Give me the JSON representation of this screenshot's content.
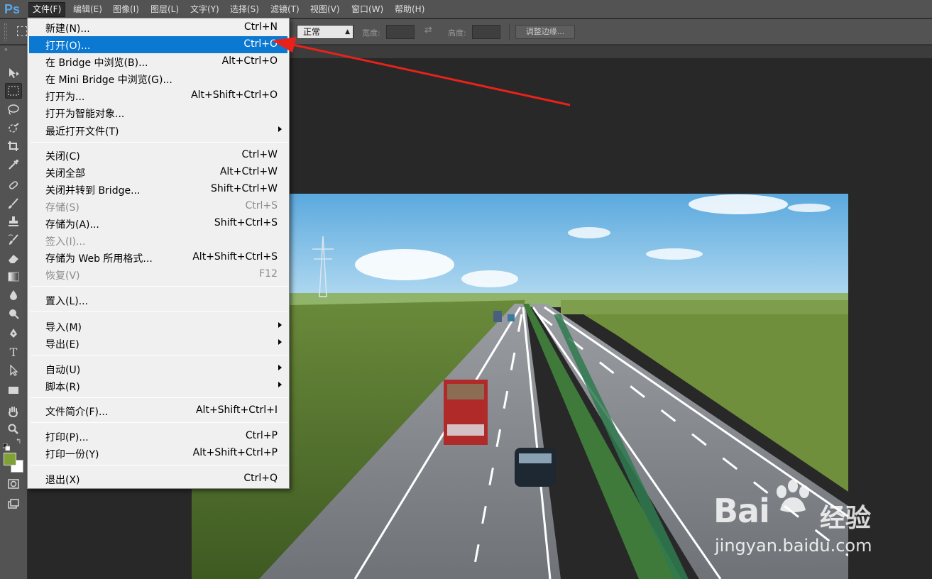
{
  "app": {
    "logo": "Ps"
  },
  "menubar": {
    "items": [
      {
        "label": "文件(F)",
        "active": true
      },
      {
        "label": "编辑(E)"
      },
      {
        "label": "图像(I)"
      },
      {
        "label": "图层(L)"
      },
      {
        "label": "文字(Y)"
      },
      {
        "label": "选择(S)"
      },
      {
        "label": "滤镜(T)"
      },
      {
        "label": "视图(V)"
      },
      {
        "label": "窗口(W)"
      },
      {
        "label": "帮助(H)"
      }
    ]
  },
  "options": {
    "style_value": "正常",
    "width_label": "宽度:",
    "height_label": "高度:",
    "refine_edge_label": "调整边缘..."
  },
  "file_menu": {
    "items": [
      {
        "label": "新建(N)...",
        "shortcut": "Ctrl+N"
      },
      {
        "label": "打开(O)...",
        "shortcut": "Ctrl+O",
        "highlighted": true
      },
      {
        "label": "在 Bridge 中浏览(B)...",
        "shortcut": "Alt+Ctrl+O"
      },
      {
        "label": "在 Mini Bridge 中浏览(G)...",
        "shortcut": ""
      },
      {
        "label": "打开为...",
        "shortcut": "Alt+Shift+Ctrl+O"
      },
      {
        "label": "打开为智能对象...",
        "shortcut": ""
      },
      {
        "label": "最近打开文件(T)",
        "shortcut": "",
        "submenu": true
      },
      {
        "label": "关闭(C)",
        "shortcut": "Ctrl+W"
      },
      {
        "label": "关闭全部",
        "shortcut": "Alt+Ctrl+W"
      },
      {
        "label": "关闭并转到 Bridge...",
        "shortcut": "Shift+Ctrl+W"
      },
      {
        "label": "存储(S)",
        "shortcut": "Ctrl+S",
        "disabled": true
      },
      {
        "label": "存储为(A)...",
        "shortcut": "Shift+Ctrl+S"
      },
      {
        "label": "签入(I)...",
        "shortcut": "",
        "disabled": true
      },
      {
        "label": "存储为 Web 所用格式...",
        "shortcut": "Alt+Shift+Ctrl+S"
      },
      {
        "label": "恢复(V)",
        "shortcut": "F12",
        "disabled": true
      },
      {
        "label": "置入(L)...",
        "shortcut": ""
      },
      {
        "label": "导入(M)",
        "shortcut": "",
        "submenu": true
      },
      {
        "label": "导出(E)",
        "shortcut": "",
        "submenu": true
      },
      {
        "label": "自动(U)",
        "shortcut": "",
        "submenu": true
      },
      {
        "label": "脚本(R)",
        "shortcut": "",
        "submenu": true
      },
      {
        "label": "文件简介(F)...",
        "shortcut": "Alt+Shift+Ctrl+I"
      },
      {
        "label": "打印(P)...",
        "shortcut": "Ctrl+P"
      },
      {
        "label": "打印一份(Y)",
        "shortcut": "Alt+Shift+Ctrl+P"
      },
      {
        "label": "退出(X)",
        "shortcut": "Ctrl+Q"
      }
    ]
  },
  "colors": {
    "foreground": "#7fa136",
    "background": "#ffffff",
    "highlight": "#0b78d1",
    "annotation_arrow": "#e8221b"
  },
  "toolbox": {
    "icons": [
      "move-icon",
      "rect-marquee-icon",
      "lasso-icon",
      "quick-select-icon",
      "crop-icon",
      "eyedropper-icon",
      "healing-brush-icon",
      "brush-icon",
      "clone-stamp-icon",
      "history-brush-icon",
      "eraser-icon",
      "gradient-icon",
      "blur-icon",
      "dodge-icon",
      "pen-icon",
      "type-icon",
      "path-select-icon",
      "rectangle-shape-icon",
      "hand-icon",
      "zoom-icon"
    ]
  },
  "watermark": {
    "brand": "Bai",
    "brand_cn": "经验",
    "url": "jingyan.baidu.com"
  }
}
